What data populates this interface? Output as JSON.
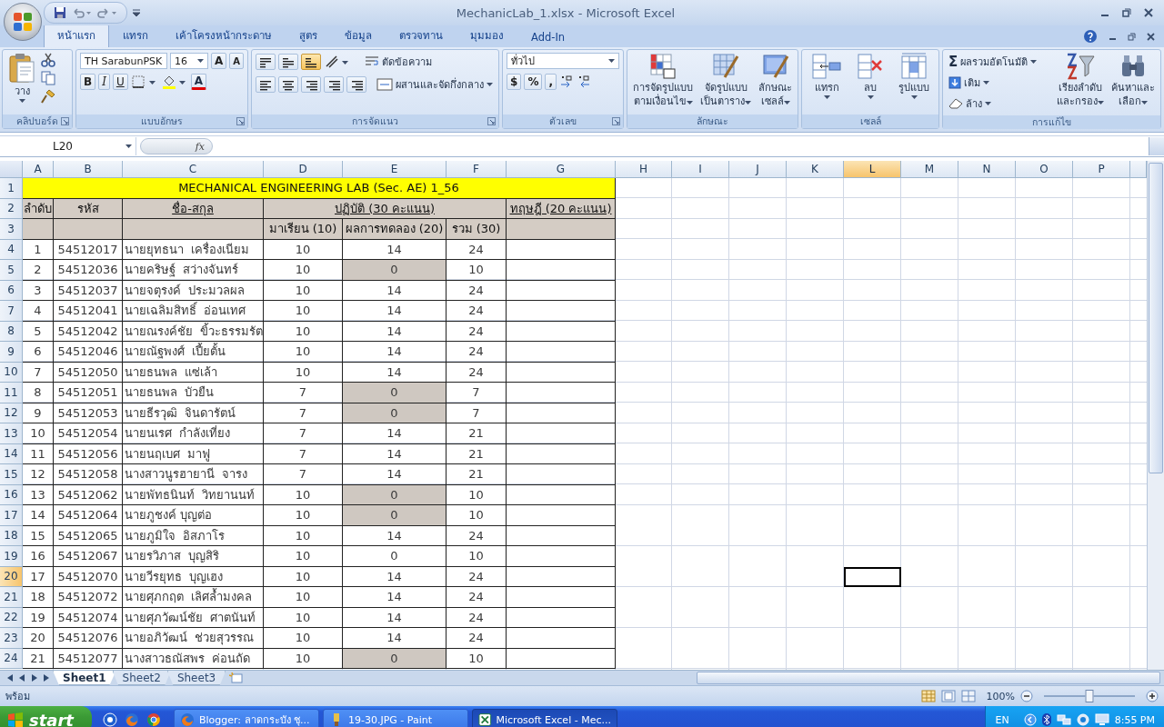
{
  "window": {
    "title": "MechanicLab_1.xlsx - Microsoft Excel"
  },
  "ribbon_tabs": [
    {
      "label": "หน้าแรก",
      "selected": true
    },
    {
      "label": "แทรก",
      "selected": false
    },
    {
      "label": "เค้าโครงหน้ากระดาษ",
      "selected": false
    },
    {
      "label": "สูตร",
      "selected": false
    },
    {
      "label": "ข้อมูล",
      "selected": false
    },
    {
      "label": "ตรวจทาน",
      "selected": false
    },
    {
      "label": "มุมมอง",
      "selected": false
    },
    {
      "label": "Add-In",
      "selected": false
    }
  ],
  "clipboard": {
    "title": "คลิปบอร์ด",
    "paste": "วาง"
  },
  "font": {
    "title": "แบบอักษร",
    "name": "TH SarabunPSK",
    "size": "16",
    "grow": "A",
    "shrink": "A",
    "styles": [
      "B",
      "I",
      "U"
    ],
    "color_letter": "A"
  },
  "alignment": {
    "title": "การจัดแนว",
    "vertical": [
      {
        "selected": false
      },
      {
        "selected": false
      },
      {
        "selected": true
      }
    ],
    "wrap": "ตัดข้อความ",
    "merge": "ผสานและจัดกึ่งกลาง"
  },
  "number": {
    "title": "ตัวเลข",
    "format": "ทั่วไป",
    "symbols": [
      "$",
      "%",
      ","
    ]
  },
  "styles": {
    "title": "ลักษณะ",
    "buttons": [
      {
        "kind": "conditional",
        "lines": [
          "การจัดรูปแบบ",
          "ตามเงื่อนไข"
        ]
      },
      {
        "kind": "table",
        "lines": [
          "จัดรูปแบบ",
          "เป็นตาราง"
        ]
      },
      {
        "kind": "cell",
        "lines": [
          "ลักษณะ",
          "เซลล์"
        ]
      }
    ]
  },
  "cells": {
    "title": "เซลล์",
    "buttons": [
      {
        "kind": "insert",
        "label": "แทรก"
      },
      {
        "kind": "delete",
        "label": "ลบ"
      },
      {
        "kind": "format",
        "label": "รูปแบบ"
      }
    ]
  },
  "editing": {
    "title": "การแก้ไข",
    "sigma": "Σ",
    "autosum": "ผลรวมอัตโนมัติ",
    "fill": "เติม",
    "clear": "ล้าง",
    "sort": [
      "เรียงลำดับ",
      "และกรอง"
    ],
    "find": [
      "ค้นหาและ",
      "เลือก"
    ]
  },
  "formula_bar": {
    "name_box": "L20",
    "fx": "fx"
  },
  "columns": [
    {
      "label": "A",
      "selected": false
    },
    {
      "label": "B",
      "selected": false
    },
    {
      "label": "C",
      "selected": false
    },
    {
      "label": "D",
      "selected": false
    },
    {
      "label": "E",
      "selected": false
    },
    {
      "label": "F",
      "selected": false
    },
    {
      "label": "G",
      "selected": false
    },
    {
      "label": "H",
      "selected": false
    },
    {
      "label": "I",
      "selected": false
    },
    {
      "label": "J",
      "selected": false
    },
    {
      "label": "K",
      "selected": false
    },
    {
      "label": "L",
      "selected": true
    },
    {
      "label": "M",
      "selected": false
    },
    {
      "label": "N",
      "selected": false
    },
    {
      "label": "O",
      "selected": false
    },
    {
      "label": "P",
      "selected": false
    }
  ],
  "row_headers": [
    {
      "label": "1",
      "selected": false
    },
    {
      "label": "2",
      "selected": false
    },
    {
      "label": "3",
      "selected": false
    },
    {
      "label": "4",
      "selected": false
    },
    {
      "label": "5",
      "selected": false
    },
    {
      "label": "6",
      "selected": false
    },
    {
      "label": "7",
      "selected": false
    },
    {
      "label": "8",
      "selected": false
    },
    {
      "label": "9",
      "selected": false
    },
    {
      "label": "10",
      "selected": false
    },
    {
      "label": "11",
      "selected": false
    },
    {
      "label": "12",
      "selected": false
    },
    {
      "label": "13",
      "selected": false
    },
    {
      "label": "14",
      "selected": false
    },
    {
      "label": "15",
      "selected": false
    },
    {
      "label": "16",
      "selected": false
    },
    {
      "label": "17",
      "selected": false
    },
    {
      "label": "18",
      "selected": false
    },
    {
      "label": "19",
      "selected": false
    },
    {
      "label": "20",
      "selected": true
    },
    {
      "label": "21",
      "selected": false
    },
    {
      "label": "22",
      "selected": false
    },
    {
      "label": "23",
      "selected": false
    },
    {
      "label": "24",
      "selected": false
    }
  ],
  "sheet_title": "MECHANICAL ENGINEERING LAB (Sec. AE) 1_56",
  "headings": {
    "no": "ลำดับ",
    "id": "รหัส",
    "name": "ชื่อ-สกุล",
    "practice": "ปฏิบัติ (30 คะแนน)",
    "theory": "ทฤษฎี (20 คะแนน)",
    "attendance": "มาเรียน (10)",
    "result": "ผลการทดลอง (20)",
    "total": "รวม (30)"
  },
  "rows": [
    {
      "no": "1",
      "id": "54512017",
      "name": "นายยุทธนา  เครื่องเนียม",
      "attendance": "10",
      "result": "14",
      "total": "24",
      "shaded": false
    },
    {
      "no": "2",
      "id": "54512036",
      "name": "นายคริษฐ์  สว่างจันทร์",
      "attendance": "10",
      "result": "0",
      "total": "10",
      "shaded": true
    },
    {
      "no": "3",
      "id": "54512037",
      "name": "นายจตุรงค์  ประมวลผล",
      "attendance": "10",
      "result": "14",
      "total": "24",
      "shaded": false
    },
    {
      "no": "4",
      "id": "54512041",
      "name": "นายเฉลิมสิทธิ์  อ่อนเทศ",
      "attendance": "10",
      "result": "14",
      "total": "24",
      "shaded": false
    },
    {
      "no": "5",
      "id": "54512042",
      "name": "นายณรงค์ชัย  ขิ้วะธรรมรัต",
      "attendance": "10",
      "result": "14",
      "total": "24",
      "shaded": false
    },
    {
      "no": "6",
      "id": "54512046",
      "name": "นายณัฐพงศ์  เปี้ยตั้น",
      "attendance": "10",
      "result": "14",
      "total": "24",
      "shaded": false
    },
    {
      "no": "7",
      "id": "54512050",
      "name": "นายธนพล  แซ่เล้า",
      "attendance": "10",
      "result": "14",
      "total": "24",
      "shaded": false
    },
    {
      "no": "8",
      "id": "54512051",
      "name": "นายธนพล  บัวยืน",
      "attendance": "7",
      "result": "0",
      "total": "7",
      "shaded": true
    },
    {
      "no": "9",
      "id": "54512053",
      "name": "นายธีรวุฒิ  จินดารัตน์",
      "attendance": "7",
      "result": "0",
      "total": "7",
      "shaded": true
    },
    {
      "no": "10",
      "id": "54512054",
      "name": "นายนเรศ  กำลังเที่ยง",
      "attendance": "7",
      "result": "14",
      "total": "21",
      "shaded": false
    },
    {
      "no": "11",
      "id": "54512056",
      "name": "นายนฤเบศ  มาฟู",
      "attendance": "7",
      "result": "14",
      "total": "21",
      "shaded": false
    },
    {
      "no": "12",
      "id": "54512058",
      "name": "นางสาวนูรฮายานี  จารง",
      "attendance": "7",
      "result": "14",
      "total": "21",
      "shaded": false
    },
    {
      "no": "13",
      "id": "54512062",
      "name": "นายพัทธนินท์  วิทยานนท์",
      "attendance": "10",
      "result": "0",
      "total": "10",
      "shaded": true
    },
    {
      "no": "14",
      "id": "54512064",
      "name": "นายภูชงค์ บุญต่อ",
      "attendance": "10",
      "result": "0",
      "total": "10",
      "shaded": true
    },
    {
      "no": "15",
      "id": "54512065",
      "name": "นายภูมิใจ  อิสภาโร",
      "attendance": "10",
      "result": "14",
      "total": "24",
      "shaded": false
    },
    {
      "no": "16",
      "id": "54512067",
      "name": "นายรวิภาส  บุญสิริ",
      "attendance": "10",
      "result": "0",
      "total": "10",
      "shaded": false
    },
    {
      "no": "17",
      "id": "54512070",
      "name": "นายวีรยุทธ  บุญเฮง",
      "attendance": "10",
      "result": "14",
      "total": "24",
      "shaded": false
    },
    {
      "no": "18",
      "id": "54512072",
      "name": "นายศุภกฤต  เลิศล้ำมงคล",
      "attendance": "10",
      "result": "14",
      "total": "24",
      "shaded": false
    },
    {
      "no": "19",
      "id": "54512074",
      "name": "นายศุภวัฒน์ชัย  ศาตนันท์",
      "attendance": "10",
      "result": "14",
      "total": "24",
      "shaded": false
    },
    {
      "no": "20",
      "id": "54512076",
      "name": "นายอภิวัฒน์  ช่วยสุวรรณ",
      "attendance": "10",
      "result": "14",
      "total": "24",
      "shaded": false
    },
    {
      "no": "21",
      "id": "54512077",
      "name": "นางสาวธณัสพร  ค่อนถัด",
      "attendance": "10",
      "result": "0",
      "total": "10",
      "shaded": true
    }
  ],
  "sheet_tabs": [
    {
      "label": "Sheet1",
      "selected": true
    },
    {
      "label": "Sheet2",
      "selected": false
    },
    {
      "label": "Sheet3",
      "selected": false
    }
  ],
  "status_bar": {
    "status": "พร้อม",
    "zoom": "100%",
    "zoom_slider": {
      "level": 0.5
    }
  },
  "taskbar": {
    "start": "start",
    "tasks": [
      {
        "kind": "browser",
        "label": "Blogger: ลาดกระบัง ชุ...",
        "selected": false
      },
      {
        "kind": "paint",
        "label": "19-30.JPG - Paint",
        "selected": false
      },
      {
        "kind": "excel",
        "label": "Microsoft Excel - Mec...",
        "selected": true
      }
    ],
    "language": "EN",
    "clock": "8:55 PM"
  }
}
